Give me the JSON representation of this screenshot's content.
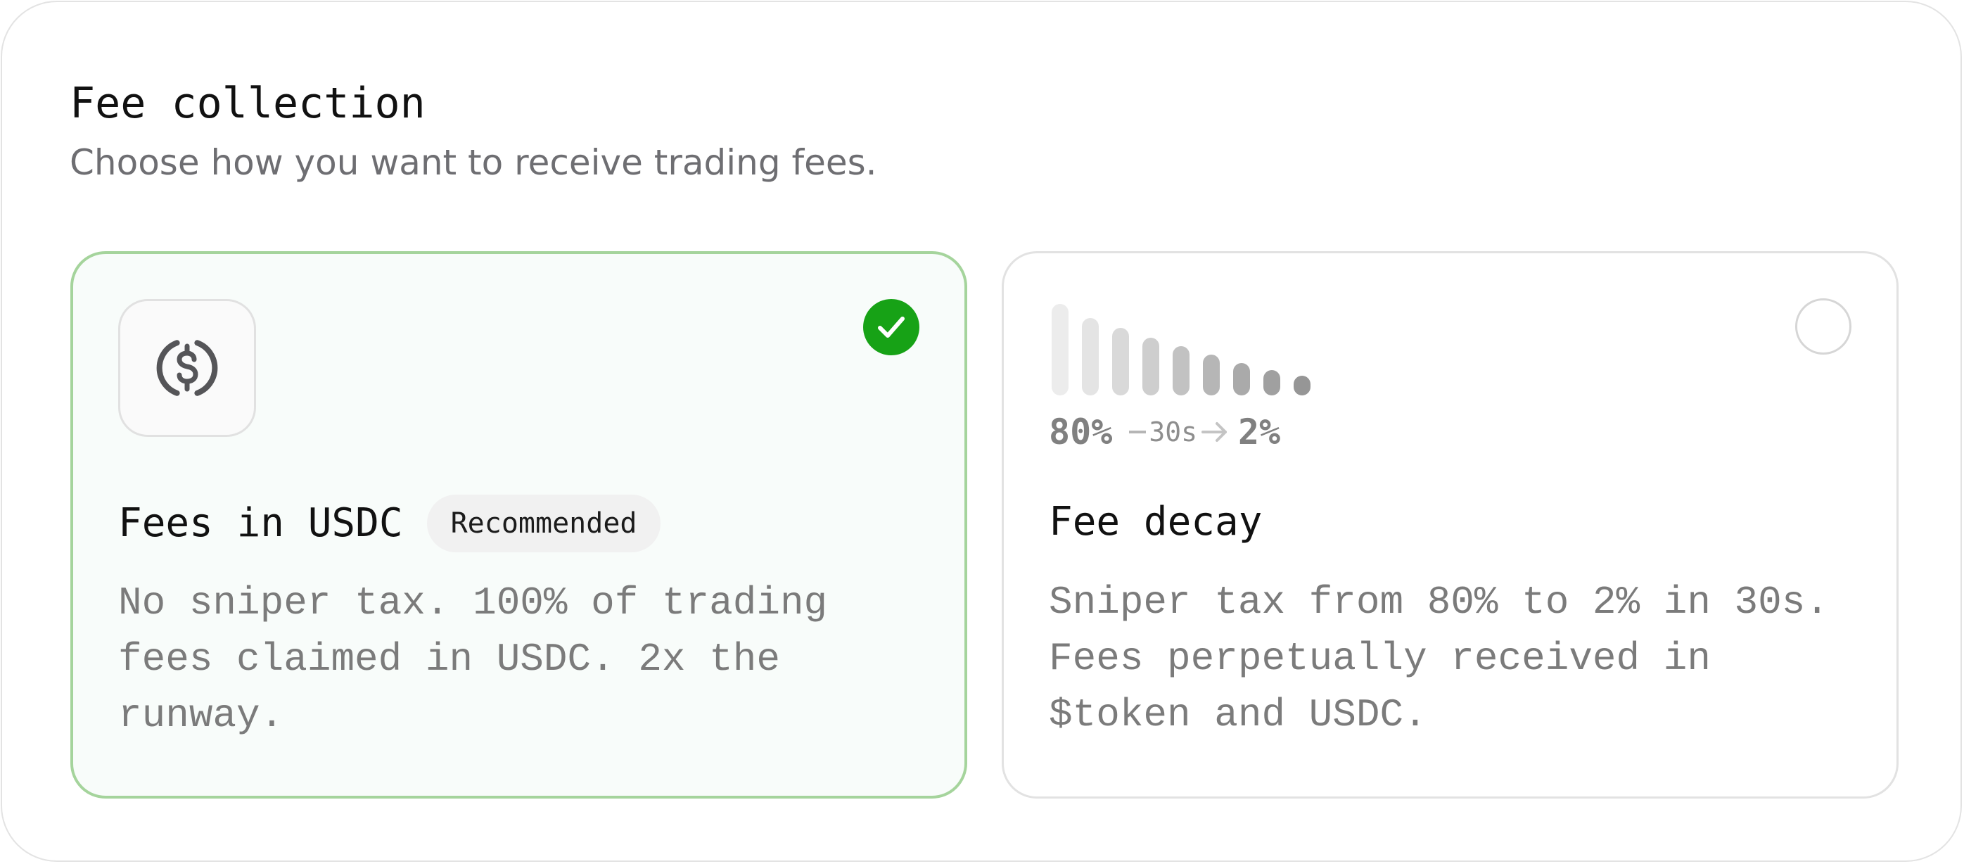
{
  "header": {
    "title": "Fee collection",
    "subtitle": "Choose how you want to receive trading fees."
  },
  "options": [
    {
      "title": "Fees in USDC",
      "badge": "Recommended",
      "description": "No sniper tax. 100% of trading fees claimed in USDC. 2x the runway.",
      "icon": "usdc-coin-icon",
      "selected": true
    },
    {
      "title": "Fee decay",
      "description": "Sniper tax from 80% to 2% in 30s. Fees perpetually received in $token and USDC.",
      "icon": "decay-bars-icon",
      "selected": false,
      "decay": {
        "from": "80%",
        "duration": "30s",
        "to": "2%"
      }
    }
  ],
  "colors": {
    "selected_border": "#a5d49c",
    "check_fill": "#17a216",
    "selected_background": "#f8fcfa"
  }
}
